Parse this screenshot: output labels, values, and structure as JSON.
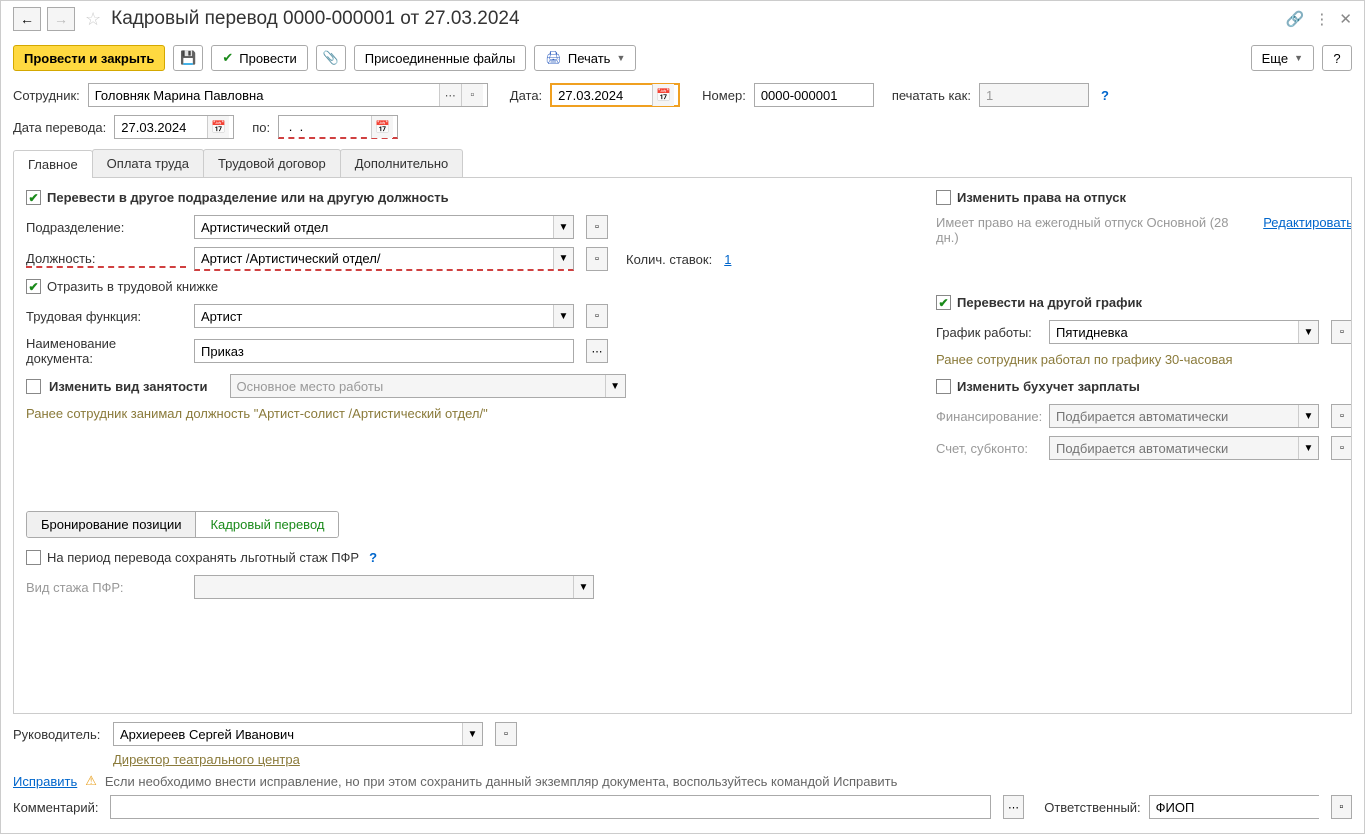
{
  "titlebar": {
    "title": "Кадровый перевод 0000-000001 от 27.03.2024"
  },
  "toolbar": {
    "post_close": "Провести и закрыть",
    "post": "Провести",
    "attached_files": "Присоединенные файлы",
    "print": "Печать",
    "more": "Еще",
    "help": "?"
  },
  "header": {
    "employee_label": "Сотрудник:",
    "employee_value": "Головняк Марина Павловна",
    "date_label": "Дата:",
    "date_value": "27.03.2024",
    "number_label": "Номер:",
    "number_value": "0000-000001",
    "print_as_label": "печатать как:",
    "print_as_value": "1",
    "transfer_date_label": "Дата перевода:",
    "transfer_date_value": "27.03.2024",
    "to_label": "по:",
    "to_value": " .  ."
  },
  "tabs": {
    "main": "Главное",
    "payment": "Оплата труда",
    "contract": "Трудовой договор",
    "additional": "Дополнительно"
  },
  "main": {
    "transfer_checkbox": "Перевести в другое подразделение или на другую должность",
    "department_label": "Подразделение:",
    "department_value": "Артистический отдел",
    "position_label": "Должность:",
    "position_value": "Артист /Артистический отдел/",
    "rates_label": "Колич. ставок:",
    "rates_value": "1",
    "workbook_checkbox": "Отразить в трудовой книжке",
    "function_label": "Трудовая функция:",
    "function_value": "Артист",
    "doc_name_label": "Наименование документа:",
    "doc_name_value": "Приказ",
    "employment_checkbox": "Изменить вид занятости",
    "employment_value": "Основное место работы",
    "prev_position": "Ранее сотрудник занимал должность \"Артист-солист /Артистический отдел/\"",
    "vacation_checkbox": "Изменить права на отпуск",
    "vacation_info": "Имеет право на ежегодный отпуск Основной (28 дн.)",
    "edit_link": "Редактировать",
    "schedule_checkbox": "Перевести на другой график",
    "schedule_label": "График работы:",
    "schedule_value": "Пятидневка",
    "prev_schedule": "Ранее сотрудник работал по графику 30-часовая",
    "accounting_checkbox": "Изменить бухучет зарплаты",
    "financing_label": "Финансирование:",
    "financing_placeholder": "Подбирается автоматически",
    "account_label": "Счет, субконто:",
    "account_placeholder": "Подбирается автоматически",
    "booking_btn": "Бронирование позиции",
    "transfer_btn": "Кадровый перевод",
    "pfr_checkbox": "На период перевода сохранять льготный стаж ПФР",
    "pfr_type_label": "Вид стажа ПФР:"
  },
  "footer": {
    "manager_label": "Руководитель:",
    "manager_value": "Архиереев Сергей Иванович",
    "manager_position": "Директор театрального центра",
    "fix_link": "Исправить",
    "fix_text": "Если необходимо внести исправление, но при этом сохранить данный экземпляр документа, воспользуйтесь командой Исправить",
    "comment_label": "Комментарий:",
    "responsible_label": "Ответственный:",
    "responsible_value": "ФИОП"
  }
}
